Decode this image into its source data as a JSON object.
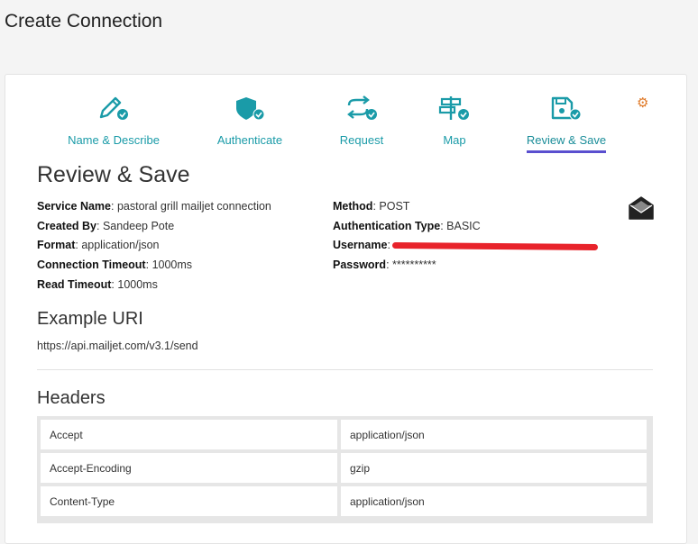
{
  "page": {
    "title": "Create Connection"
  },
  "steps": [
    {
      "label": "Name & Describe",
      "icon": "pencil-check-icon"
    },
    {
      "label": "Authenticate",
      "icon": "shield-check-icon"
    },
    {
      "label": "Request",
      "icon": "arrows-exchange-icon"
    },
    {
      "label": "Map",
      "icon": "signpost-check-icon"
    },
    {
      "label": "Review & Save",
      "icon": "floppy-check-icon",
      "active": true
    }
  ],
  "review": {
    "title": "Review & Save",
    "service_name_label": "Service Name",
    "service_name": "pastoral grill mailjet connection",
    "created_by_label": "Created By",
    "created_by": "Sandeep Pote",
    "format_label": "Format",
    "format": "application/json",
    "conn_timeout_label": "Connection Timeout",
    "conn_timeout": "1000ms",
    "read_timeout_label": "Read Timeout",
    "read_timeout": "1000ms",
    "method_label": "Method",
    "method": "POST",
    "auth_type_label": "Authentication Type",
    "auth_type": "BASIC",
    "username_label": "Username",
    "password_label": "Password",
    "password": "**********"
  },
  "example_uri": {
    "title": "Example URI",
    "url": "https://api.mailjet.com/v3.1/send"
  },
  "headers": {
    "title": "Headers",
    "rows": [
      {
        "key": "Accept",
        "value": "application/json"
      },
      {
        "key": "Accept-Encoding",
        "value": "gzip"
      },
      {
        "key": "Content-Type",
        "value": "application/json"
      }
    ]
  },
  "colors": {
    "accent": "#1a9ba8",
    "active_underline": "#5a4fcf",
    "gear": "#e07b2a",
    "redaction": "#e8232b"
  }
}
